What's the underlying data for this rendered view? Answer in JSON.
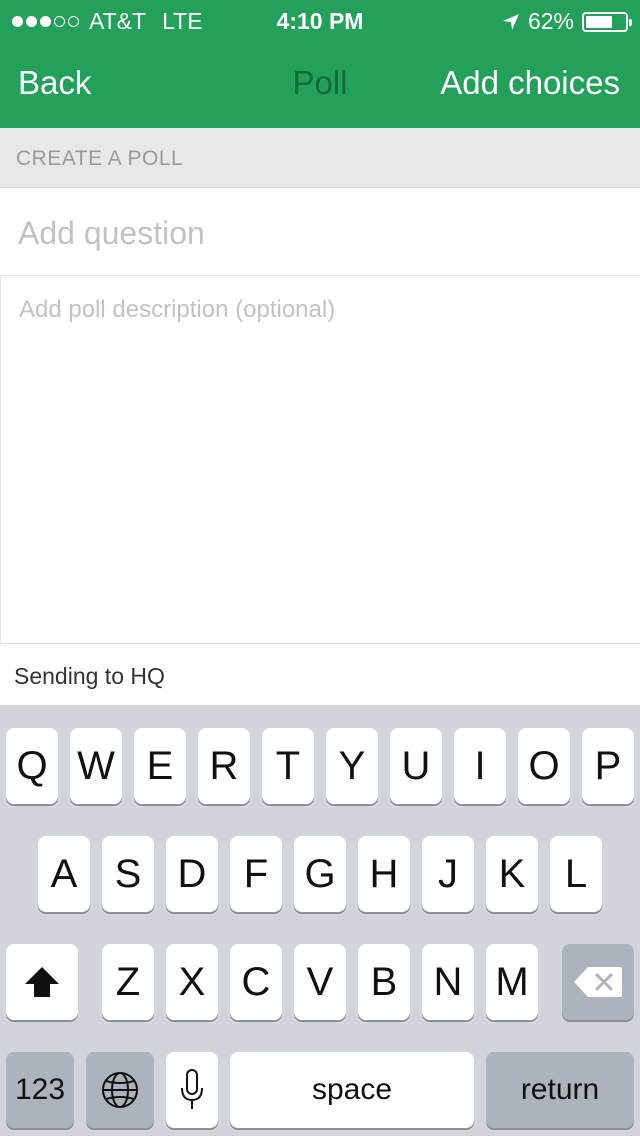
{
  "status_bar": {
    "carrier": "AT&T",
    "network": "LTE",
    "time": "4:10 PM",
    "battery": "62%",
    "battery_level": 0.62,
    "signal_bars_filled": 3,
    "signal_bars_total": 5,
    "location_icon": "location-arrow-icon"
  },
  "nav": {
    "back_label": "Back",
    "title": "Poll",
    "action_label": "Add choices"
  },
  "form": {
    "section_header": "CREATE A POLL",
    "question_placeholder": "Add question",
    "description_placeholder": "Add poll description (optional)",
    "sending_to": "Sending to HQ"
  },
  "keyboard": {
    "row1": [
      "Q",
      "W",
      "E",
      "R",
      "T",
      "Y",
      "U",
      "I",
      "O",
      "P"
    ],
    "row2": [
      "A",
      "S",
      "D",
      "F",
      "G",
      "H",
      "J",
      "K",
      "L"
    ],
    "row3": [
      "Z",
      "X",
      "C",
      "V",
      "B",
      "N",
      "M"
    ],
    "numbers_label": "123",
    "space_label": "space",
    "return_label": "return",
    "shift_icon": "shift-icon",
    "delete_icon": "delete-icon",
    "globe_icon": "globe-icon",
    "mic_icon": "microphone-icon"
  },
  "colors": {
    "header_bg": "#23a05a",
    "title_color": "#136b3a",
    "keyboard_bg": "#d1d5db"
  }
}
